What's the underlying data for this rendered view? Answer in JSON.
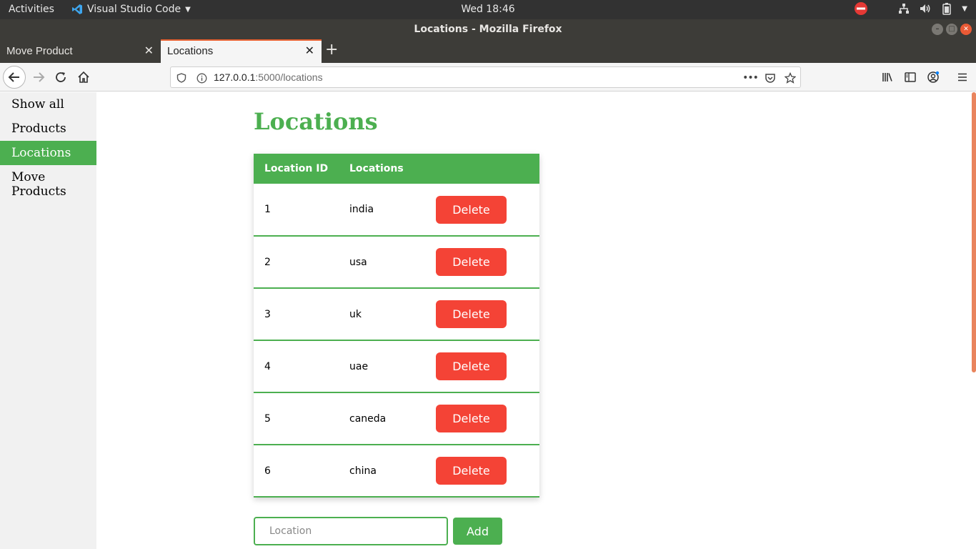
{
  "system": {
    "activities": "Activities",
    "app_name": "Visual Studio Code",
    "clock": "Wed 18:46"
  },
  "window": {
    "title": "Locations - Mozilla Firefox"
  },
  "tabs": [
    {
      "label": "Move Product",
      "active": false
    },
    {
      "label": "Locations",
      "active": true
    }
  ],
  "navbar": {
    "url_host": "127.0.0.1",
    "url_rest": ":5000/locations"
  },
  "sidebar": {
    "items": [
      {
        "label": "Show all",
        "active": false
      },
      {
        "label": "Products",
        "active": false
      },
      {
        "label": "Locations",
        "active": true
      },
      {
        "label": "Move Products",
        "active": false
      }
    ]
  },
  "main": {
    "title": "Locations",
    "table": {
      "headers": [
        "Location ID",
        "Locations",
        ""
      ],
      "rows": [
        {
          "id": "1",
          "name": "india",
          "action": "Delete"
        },
        {
          "id": "2",
          "name": "usa",
          "action": "Delete"
        },
        {
          "id": "3",
          "name": "uk",
          "action": "Delete"
        },
        {
          "id": "4",
          "name": "uae",
          "action": "Delete"
        },
        {
          "id": "5",
          "name": "caneda",
          "action": "Delete"
        },
        {
          "id": "6",
          "name": "china",
          "action": "Delete"
        }
      ]
    },
    "form": {
      "placeholder": "Location",
      "value": "",
      "add_label": "Add"
    }
  },
  "colors": {
    "accent": "#4caf50",
    "danger": "#f44336",
    "tab_highlight": "#e66030"
  }
}
